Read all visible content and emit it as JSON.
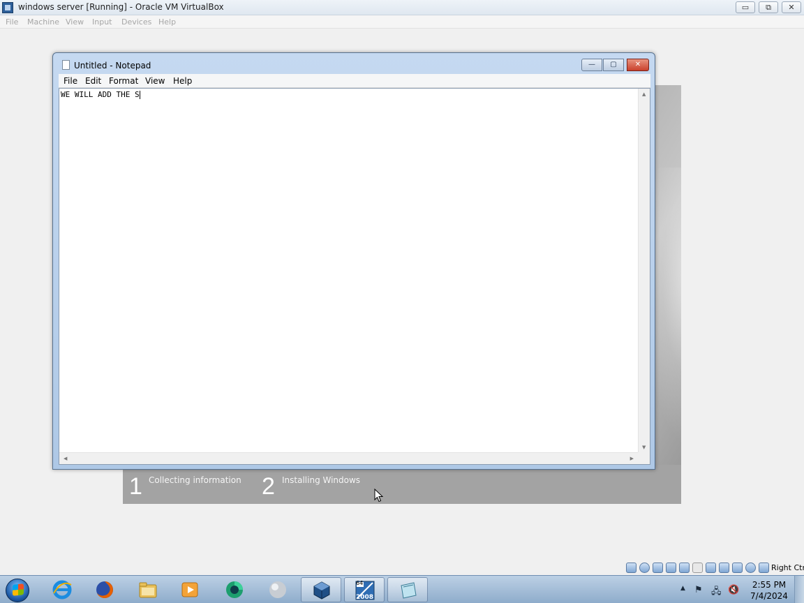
{
  "host": {
    "title": "windows server [Running] - Oracle VM VirtualBox",
    "controls": {
      "minimize": "▭",
      "restore": "⧉",
      "close": "✕"
    },
    "menu": [
      "File",
      "Machine",
      "View",
      "Input",
      "Devices",
      "Help"
    ],
    "hostkey": "Right Ctrl"
  },
  "setup": {
    "steps": [
      {
        "number": "1",
        "label": "Collecting information"
      },
      {
        "number": "2",
        "label": "Installing Windows"
      }
    ]
  },
  "notepad": {
    "title": "Untitled - Notepad",
    "controls": {
      "minimize": "—",
      "maximize": "▢",
      "close": "✕"
    },
    "menu": [
      "File",
      "Edit",
      "Format",
      "View",
      "Help"
    ],
    "content": "WE WILL ADD THE S"
  },
  "taskbar": {
    "apps": [
      {
        "icon": "internet-explorer-icon"
      },
      {
        "icon": "firefox-icon"
      },
      {
        "icon": "file-explorer-icon"
      },
      {
        "icon": "media-player-icon"
      },
      {
        "icon": "green-circle-app-icon"
      },
      {
        "icon": "gray-sphere-app-icon"
      },
      {
        "icon": "virtualbox-icon"
      },
      {
        "icon": "windows-server-2008-icon",
        "badge_top": "64",
        "badge_bottom": "2008"
      },
      {
        "icon": "notepad-icon"
      }
    ],
    "clock": {
      "time": "2:55 PM",
      "date": "7/4/2024"
    }
  },
  "colors": {
    "accent": "#1d5aa6",
    "close_red": "#c9402c",
    "setup_gray": "#a3a3a3"
  }
}
